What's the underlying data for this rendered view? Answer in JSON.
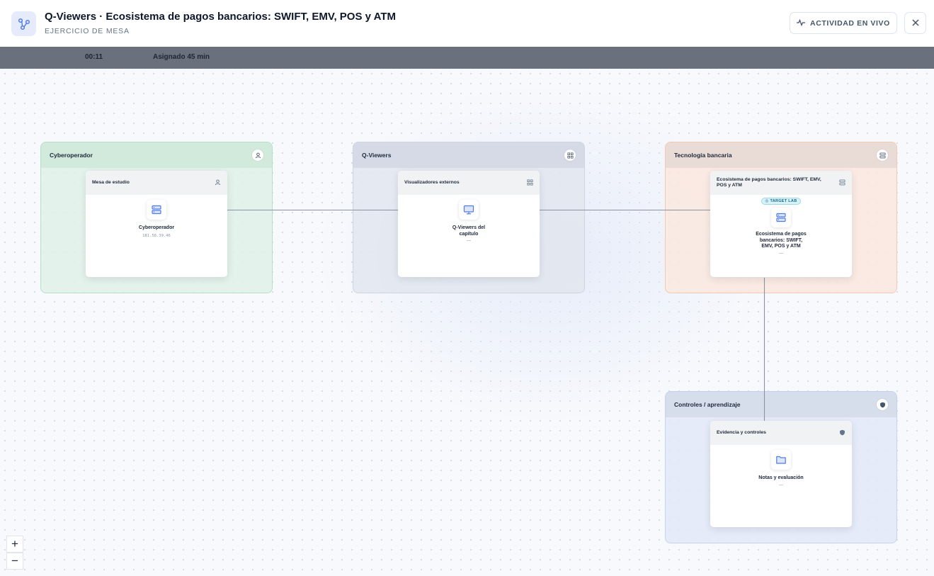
{
  "header": {
    "title": "Q-Viewers · Ecosistema de pagos bancarios: SWIFT, EMV, POS y ATM",
    "subtitle": "EJERCICIO DE MESA",
    "live_label": "ACTIVIDAD EN VIVO"
  },
  "timer": {
    "elapsed": "00:11",
    "assigned": "Asignado 45 min"
  },
  "groups": [
    {
      "title": "Cyberoperador",
      "icon": "user-icon",
      "node": {
        "title": "Mesa de estudio",
        "label": "Cyberoperador",
        "sub": "181.58.39.46",
        "icon": "server-icon"
      }
    },
    {
      "title": "Q-Viewers",
      "icon": "grid-icon",
      "node": {
        "title": "Visualizadores externos",
        "label": "Q-Viewers del capítulo",
        "sub": "—",
        "icon": "monitor-icon"
      }
    },
    {
      "title": "Tecnología bancaria",
      "icon": "server-icon",
      "node": {
        "title": "Ecosistema de pagos bancarios: SWIFT, EMV, POS y ATM",
        "badge": "TARGET LAB",
        "label": "Ecosistema de pagos bancarios: SWIFT, EMV, POS y ATM",
        "sub": "—",
        "icon": "server-icon"
      }
    },
    {
      "title": "Controles / aprendizaje",
      "icon": "shield-icon",
      "node": {
        "title": "Evidencia y controles",
        "label": "Notas y evaluación",
        "sub": "—",
        "icon": "folder-icon"
      }
    }
  ],
  "zoom": {
    "in": "+",
    "out": "−"
  },
  "colors": {
    "accent": "#4f7be8",
    "edge": "#8a93a3",
    "badge": "#0e6b8a"
  }
}
